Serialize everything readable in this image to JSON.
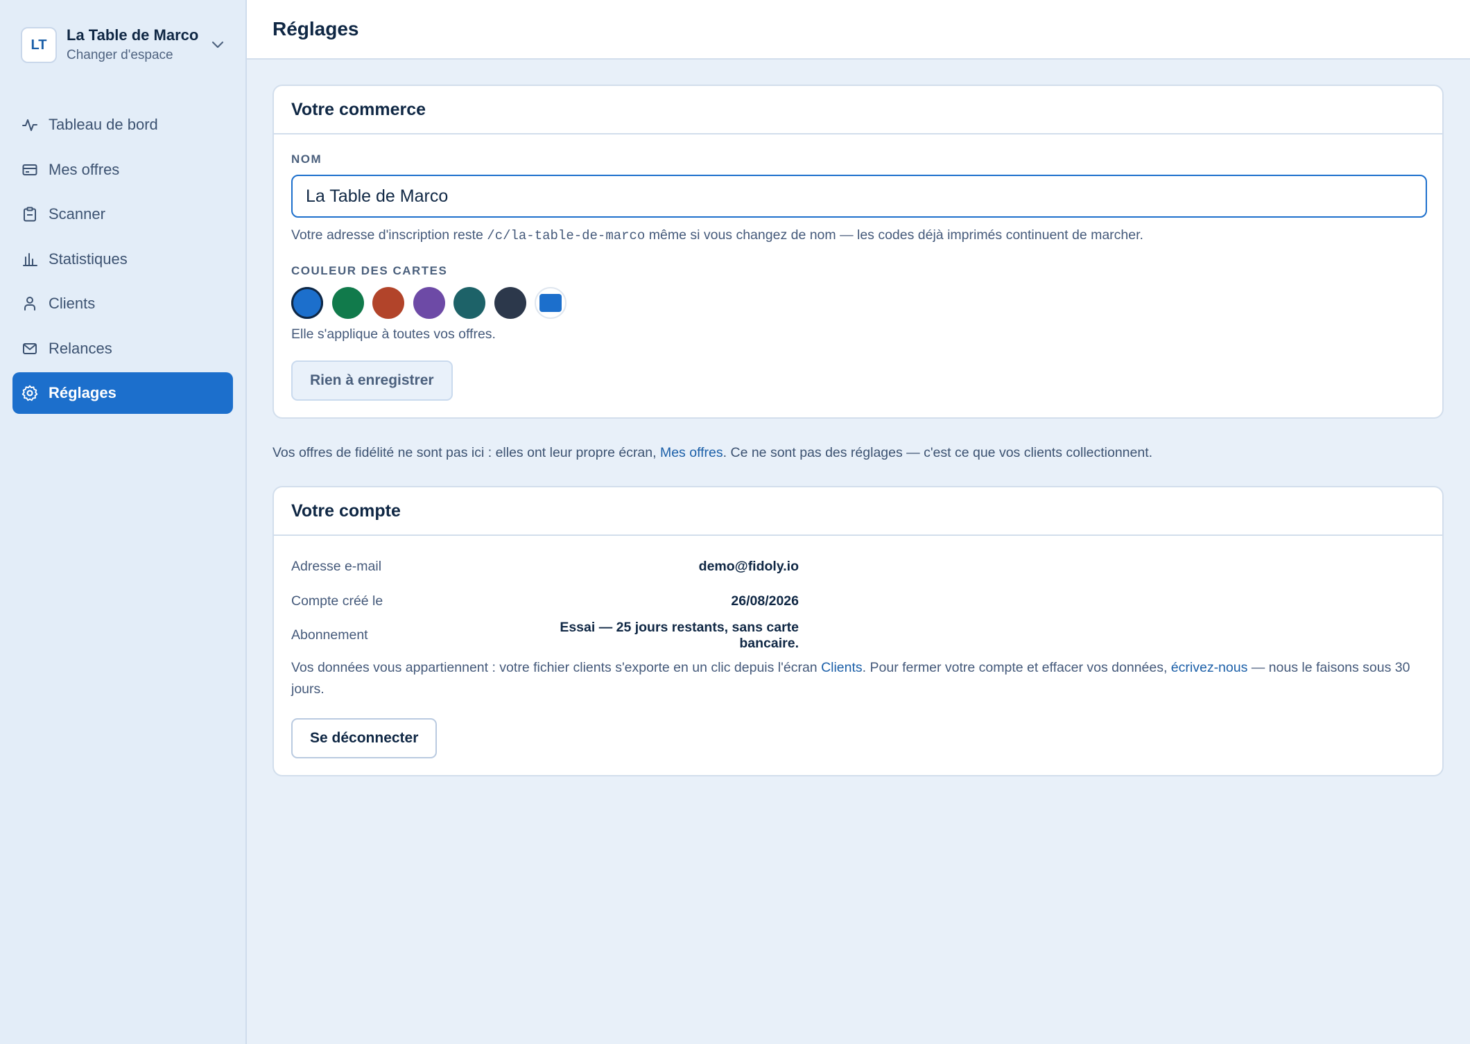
{
  "workspace": {
    "initials": "LT",
    "name": "La Table de Marco",
    "switch_label": "Changer d'espace"
  },
  "nav": {
    "items": [
      {
        "label": "Tableau de bord",
        "icon": "activity-icon"
      },
      {
        "label": "Mes offres",
        "icon": "card-icon"
      },
      {
        "label": "Scanner",
        "icon": "clipboard-icon"
      },
      {
        "label": "Statistiques",
        "icon": "bar-chart-icon"
      },
      {
        "label": "Clients",
        "icon": "user-icon"
      },
      {
        "label": "Relances",
        "icon": "mail-icon"
      },
      {
        "label": "Réglages",
        "icon": "gear-icon",
        "active": true
      }
    ]
  },
  "header": {
    "title": "Réglages"
  },
  "business": {
    "title": "Votre commerce",
    "name_label": "NOM",
    "name_value": "La Table de Marco",
    "hint_before": "Votre adresse d'inscription reste ",
    "hint_code": "/c/la-table-de-marco",
    "hint_after": " même si vous changez de nom — les codes déjà imprimés continuent de marcher.",
    "color_label": "COULEUR DES CARTES",
    "colors": [
      "#1c6fcc",
      "#117a4b",
      "#b2442a",
      "#6d4aa6",
      "#1d6268",
      "#2c384b"
    ],
    "selected_color": "#1c6fcc",
    "color_hint": "Elle s'applique à toutes vos offres.",
    "save_label": "Rien à enregistrer"
  },
  "note": {
    "before": "Vos offres de fidélité ne sont pas ici : elles ont leur propre écran, ",
    "link": "Mes offres",
    "after": ". Ce ne sont pas des réglages — c'est ce que vos clients collectionnent."
  },
  "account": {
    "title": "Votre compte",
    "rows": [
      {
        "label": "Adresse e-mail",
        "value": "demo@fidoly.io"
      },
      {
        "label": "Compte créé le",
        "value": "26/08/2026"
      },
      {
        "label": "Abonnement",
        "value": "Essai — 25 jours restants, sans carte bancaire."
      }
    ],
    "note_part1": "Vos données vous appartiennent : votre fichier clients s'exporte en un clic depuis l'écran ",
    "note_link1": "Clients",
    "note_part2": ". Pour fermer votre compte et effacer vos données, ",
    "note_link2": "écrivez-nous",
    "note_part3": " — nous le faisons sous 30 jours.",
    "logout_label": "Se déconnecter"
  }
}
